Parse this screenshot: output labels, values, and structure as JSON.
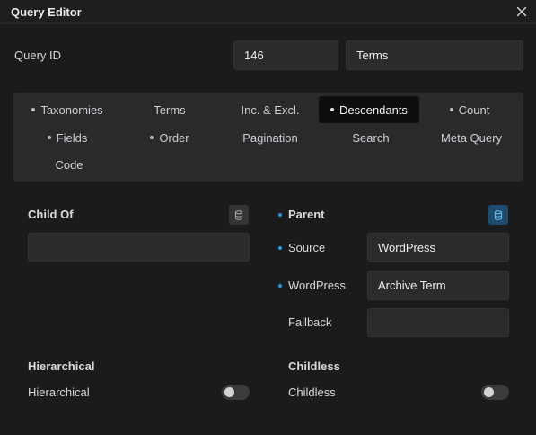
{
  "window": {
    "title": "Query Editor"
  },
  "query_id": {
    "label": "Query ID",
    "id_value": "146",
    "type_value": "Terms"
  },
  "tabs": [
    {
      "label": "Taxonomies",
      "dot": true,
      "active": false
    },
    {
      "label": "Terms",
      "dot": false,
      "active": false
    },
    {
      "label": "Inc. & Excl.",
      "dot": false,
      "active": false
    },
    {
      "label": "Descendants",
      "dot": true,
      "active": true
    },
    {
      "label": "Count",
      "dot": true,
      "active": false
    },
    {
      "label": "Fields",
      "dot": true,
      "active": false
    },
    {
      "label": "Order",
      "dot": true,
      "active": false
    },
    {
      "label": "Pagination",
      "dot": false,
      "active": false
    },
    {
      "label": "Search",
      "dot": false,
      "active": false
    },
    {
      "label": "Meta Query",
      "dot": false,
      "active": false
    },
    {
      "label": "Code",
      "dot": false,
      "active": false
    }
  ],
  "child_of": {
    "label": "Child Of",
    "value": ""
  },
  "parent": {
    "label": "Parent",
    "source_label": "Source",
    "source_value": "WordPress",
    "wordpress_label": "WordPress",
    "wordpress_value": "Archive Term",
    "fallback_label": "Fallback",
    "fallback_value": ""
  },
  "hierarchical": {
    "heading": "Hierarchical",
    "label": "Hierarchical",
    "enabled": false
  },
  "childless": {
    "heading": "Childless",
    "label": "Childless",
    "enabled": false
  },
  "colors": {
    "accent": "#2a9bdf",
    "active_tab": "#0e0e10",
    "panel": "#2a2a2d",
    "background": "#1b1b1d"
  },
  "icons": {
    "close": "close-icon",
    "dynamic": "database-icon"
  }
}
